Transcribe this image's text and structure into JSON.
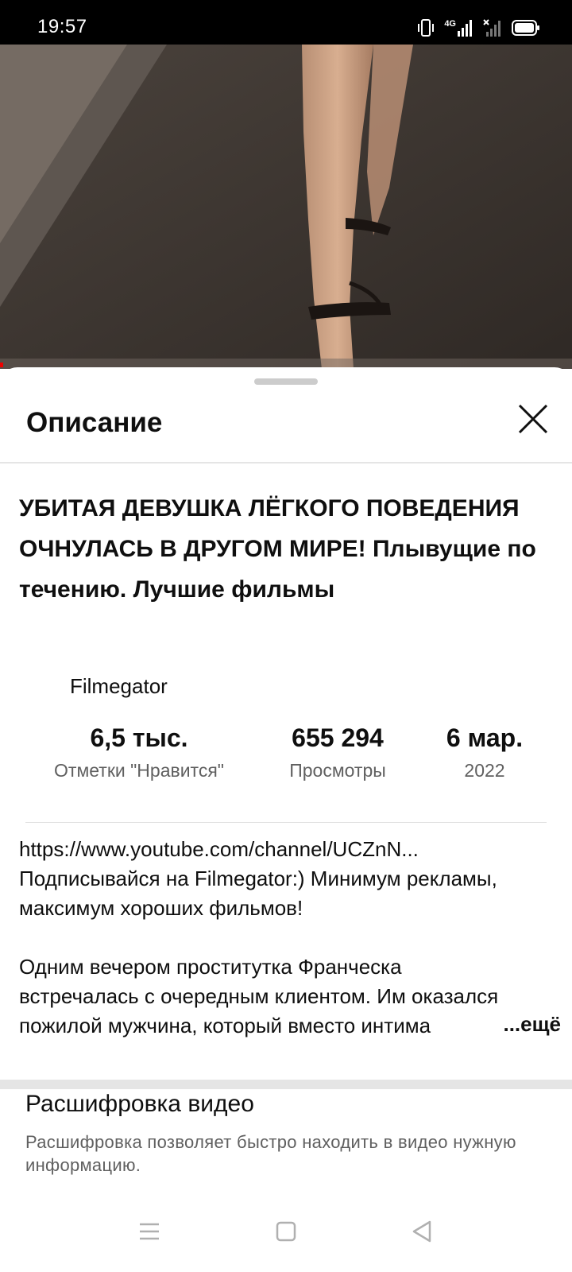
{
  "status_bar": {
    "time": "19:57",
    "icons": [
      "vibrate-icon",
      "signal-4g-icon",
      "signal-no-sim-icon",
      "battery-icon"
    ],
    "network_label": "4G"
  },
  "video": {
    "player_state": "playing",
    "progress_color": "#ee0000"
  },
  "sheet": {
    "title": "Описание",
    "close_icon": "close-icon"
  },
  "video_info": {
    "title": "УБИТАЯ ДЕВУШКА ЛЁГКОГО ПОВЕДЕНИЯ ОЧНУЛАСЬ В ДРУГОМ МИРЕ! Плывущие по течению. Лучшие фильмы",
    "channel": "Filmegator"
  },
  "stats": {
    "likes_value": "6,5 тыс.",
    "likes_label": "Отметки \"Нравится\"",
    "views_value": "655 294",
    "views_label": "Просмотры",
    "date_value": "6 мар.",
    "date_label": "2022"
  },
  "description": {
    "line1": "https://www.youtube.com/channel/UCZnN...",
    "line2": "Подписывайся на Filmegator:)  Минимум рекламы,",
    "line3": "максимум хороших фильмов!",
    "line4": "Одним вечером проститутка Франческа",
    "line5": "встречалась с очередным клиентом. Им оказался",
    "line6": "пожилой мужчина, который вместо интима",
    "more_label": "...ещё"
  },
  "transcript": {
    "title": "Расшифровка видео",
    "text": "Расшифровка позволяет быстро находить в видео нужную информацию."
  },
  "nav_bar": {
    "buttons": [
      "menu-icon",
      "home-square-icon",
      "back-triangle-icon"
    ]
  }
}
